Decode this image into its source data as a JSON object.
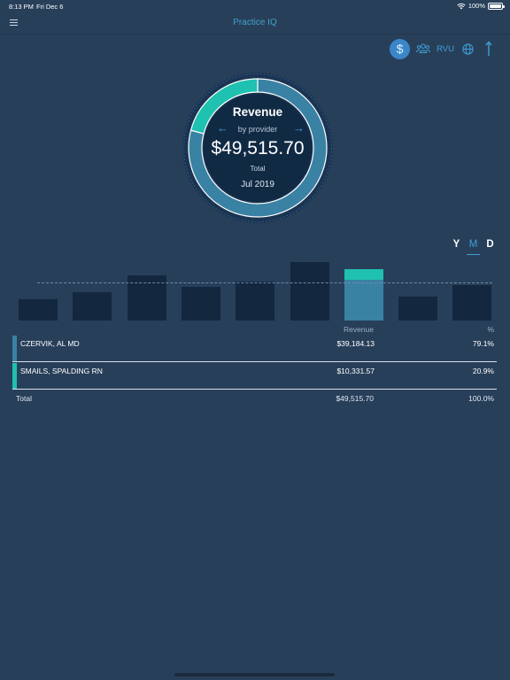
{
  "status_bar": {
    "time": "8:13 PM",
    "date": "Fri Dec 6",
    "battery": "100%"
  },
  "nav": {
    "title": "Practice IQ"
  },
  "toolbar": {
    "dollar_symbol": "$",
    "rvu_label": "RVU",
    "active": "dollar-icon"
  },
  "donut": {
    "title": "Revenue",
    "subtitle": "by provider",
    "prev_arrow": "←",
    "next_arrow": "→",
    "value": "$49,515.70",
    "total_label": "Total",
    "period": "Jul 2019",
    "segments": [
      {
        "name": "CZERVIK, AL MD",
        "share": 0.791,
        "color": "#3982a3"
      },
      {
        "name": "SMAILS, SPALDING RN",
        "share": 0.209,
        "color": "#1fc1b0"
      }
    ]
  },
  "period_selector": {
    "options": [
      "Y",
      "M",
      "D"
    ],
    "active": "M"
  },
  "chart_data": {
    "type": "bar",
    "title": "",
    "xlabel": "",
    "ylabel": "",
    "bar_heights_relative": [
      0.37,
      0.49,
      0.78,
      0.58,
      0.66,
      1.0,
      0.88,
      0.41,
      0.61
    ],
    "selected_index": 6,
    "selected_split": [
      0.791,
      0.209
    ],
    "average_relative": 0.65,
    "colors": {
      "bar": "#13273f",
      "segment_primary": "#3982a3",
      "segment_secondary": "#1fc1b0"
    }
  },
  "table": {
    "headers": {
      "revenue": "Revenue",
      "percent": "%"
    },
    "rows": [
      {
        "name": "CZERVIK, AL MD",
        "revenue": "$39,184.13",
        "percent": "79.1%",
        "color": "#3982a3"
      },
      {
        "name": "SMAILS, SPALDING RN",
        "revenue": "$10,331.57",
        "percent": "20.9%",
        "color": "#1fc1b0"
      }
    ],
    "total": {
      "label": "Total",
      "revenue": "$49,515.70",
      "percent": "100.0%"
    }
  }
}
